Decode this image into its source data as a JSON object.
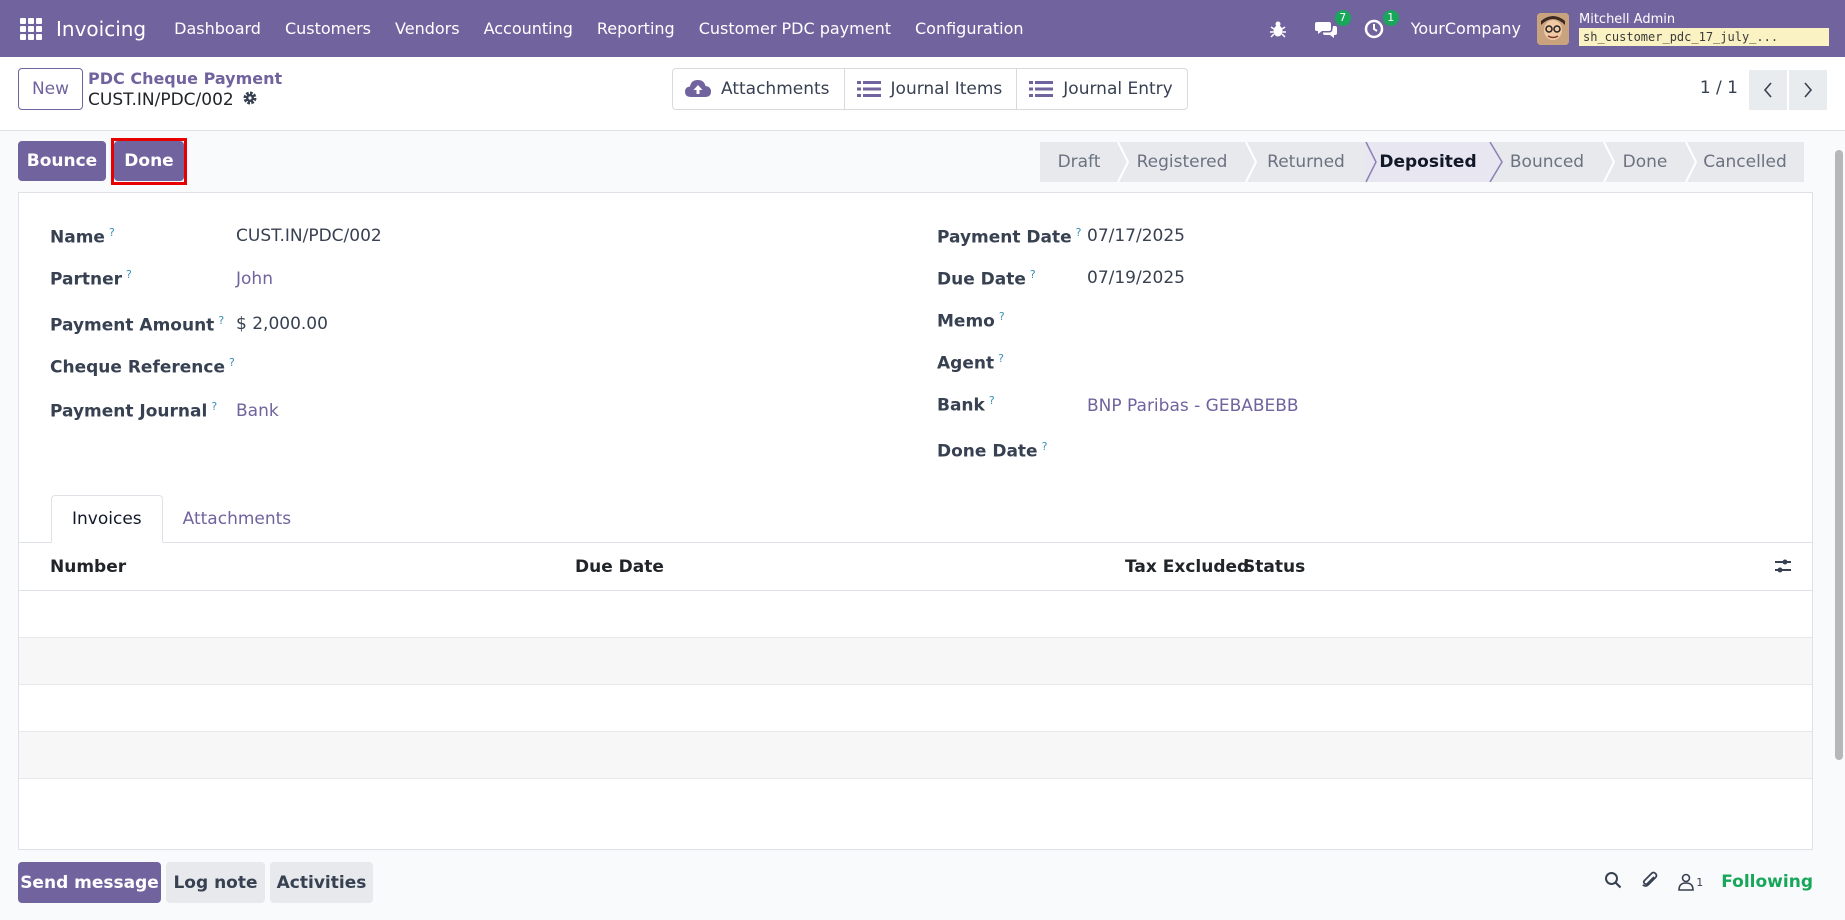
{
  "navbar": {
    "app_name": "Invoicing",
    "menu": [
      "Dashboard",
      "Customers",
      "Vendors",
      "Accounting",
      "Reporting",
      "Customer PDC payment",
      "Configuration"
    ],
    "messages_count": "7",
    "activities_count": "1",
    "company": "YourCompany",
    "user_name": "Mitchell Admin",
    "database": "sh_customer_pdc_17_july_..."
  },
  "control": {
    "new_label": "New",
    "breadcrumb": "PDC Cheque Payment",
    "record_name": "CUST.IN/PDC/002",
    "smart_buttons": [
      "Attachments",
      "Journal Items",
      "Journal Entry"
    ],
    "pager": "1 / 1"
  },
  "actions": {
    "bounce_label": "Bounce",
    "done_label": "Done"
  },
  "statusbar": {
    "stages": [
      "Draft",
      "Registered",
      "Returned",
      "Deposited",
      "Bounced",
      "Done",
      "Cancelled"
    ],
    "active": "Deposited"
  },
  "form": {
    "left": [
      {
        "label": "Name",
        "value": "CUST.IN/PDC/002",
        "link": false
      },
      {
        "label": "Partner",
        "value": "John",
        "link": true
      },
      {
        "label": "Payment Amount",
        "value": "$ 2,000.00",
        "link": false
      },
      {
        "label": "Cheque Reference",
        "value": "",
        "link": false
      },
      {
        "label": "Payment Journal",
        "value": "Bank",
        "link": true
      }
    ],
    "right": [
      {
        "label": "Payment Date",
        "value": "07/17/2025",
        "link": false
      },
      {
        "label": "Due Date",
        "value": "07/19/2025",
        "link": false
      },
      {
        "label": "Memo",
        "value": "",
        "link": false
      },
      {
        "label": "Agent",
        "value": "",
        "link": false
      },
      {
        "label": "Bank",
        "value": "BNP Paribas - GEBABEBB",
        "link": true
      },
      {
        "label": "Done Date",
        "value": "",
        "link": false
      }
    ],
    "help_marker": "?"
  },
  "tabs": [
    "Invoices",
    "Attachments"
  ],
  "table": {
    "columns": [
      "Number",
      "Due Date",
      "Tax Excluded",
      "Status"
    ]
  },
  "chatter": {
    "send_message": "Send message",
    "log_note": "Log note",
    "activities": "Activities",
    "followers_count": "1",
    "following": "Following"
  },
  "colors": {
    "brand": "#71639e",
    "highlight": "#e60000",
    "success": "#17a65a"
  }
}
